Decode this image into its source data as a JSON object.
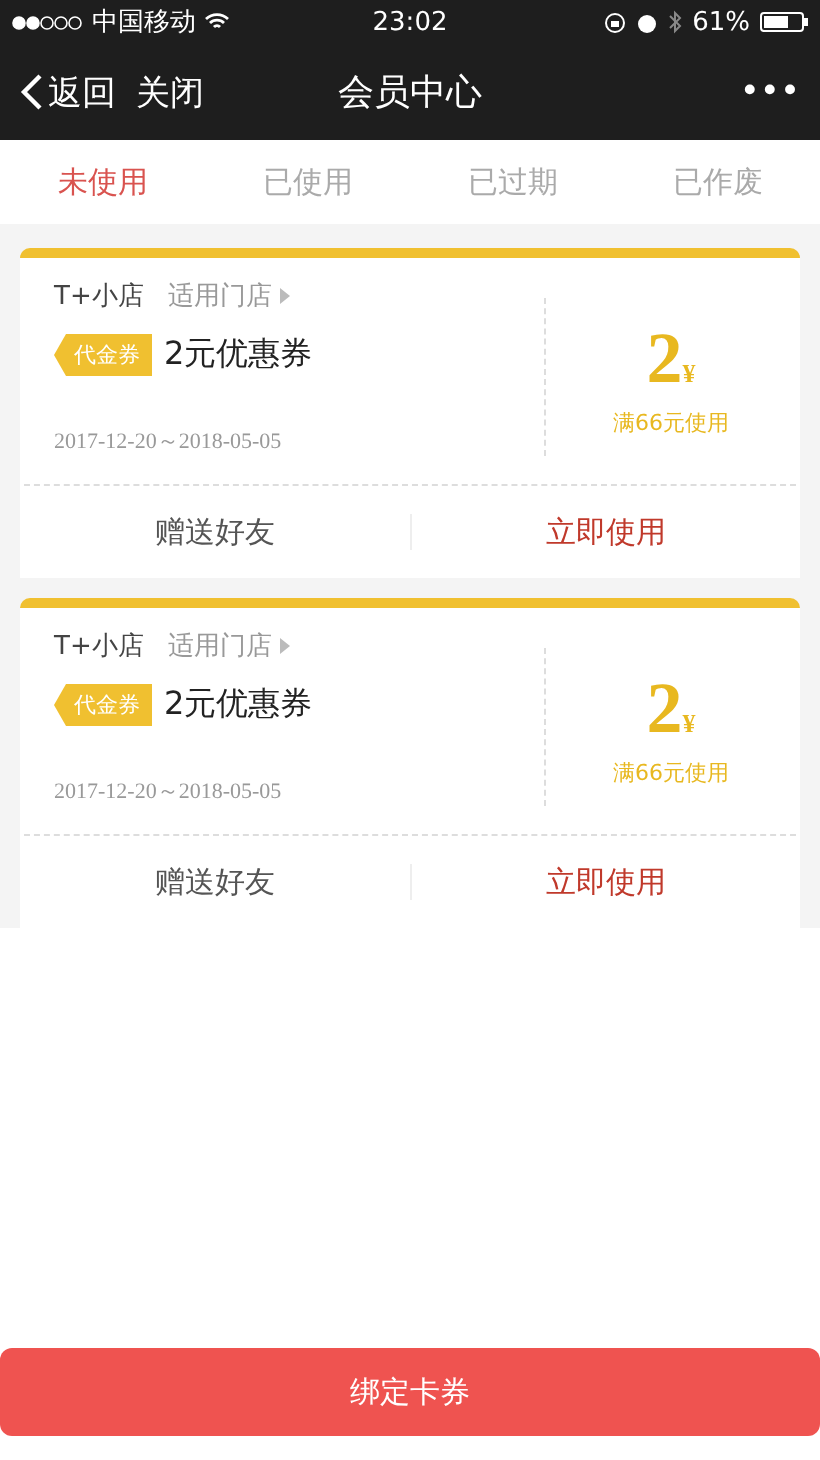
{
  "status_bar": {
    "carrier": "中国移动",
    "time": "23:02",
    "battery": "61%"
  },
  "nav": {
    "back": "返回",
    "close": "关闭",
    "title": "会员中心",
    "more": "•••"
  },
  "tabs": [
    {
      "label": "未使用",
      "selected": true
    },
    {
      "label": "已使用",
      "selected": false
    },
    {
      "label": "已过期",
      "selected": false
    },
    {
      "label": "已作废",
      "selected": false
    }
  ],
  "coupons": [
    {
      "store": "T+小店",
      "stores_link": "适用门店",
      "tag": "代金券",
      "name": "2元优惠券",
      "dates": "2017-12-20～2018-05-05",
      "amount": "2",
      "currency": "¥",
      "condition": "满66元使用",
      "gift": "赠送好友",
      "use": "立即使用"
    },
    {
      "store": "T+小店",
      "stores_link": "适用门店",
      "tag": "代金券",
      "name": "2元优惠券",
      "dates": "2017-12-20～2018-05-05",
      "amount": "2",
      "currency": "¥",
      "condition": "满66元使用",
      "gift": "赠送好友",
      "use": "立即使用"
    }
  ],
  "bind_button": "绑定卡券"
}
